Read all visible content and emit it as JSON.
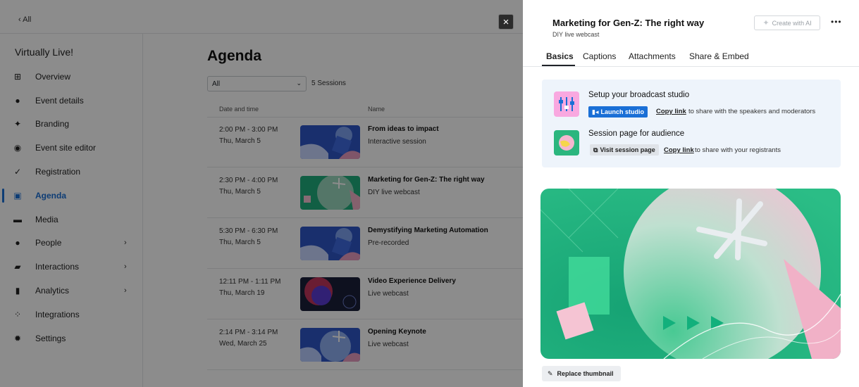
{
  "topbar": {
    "back_label": "All"
  },
  "sidebar": {
    "event_name": "Virtually Live!",
    "items": [
      {
        "label": "Overview",
        "icon": "grid-icon",
        "chevron": false
      },
      {
        "label": "Event details",
        "icon": "info-icon",
        "chevron": false
      },
      {
        "label": "Branding",
        "icon": "sparkle-icon",
        "chevron": false
      },
      {
        "label": "Event site editor",
        "icon": "globe-icon",
        "chevron": false
      },
      {
        "label": "Registration",
        "icon": "check-icon",
        "chevron": false
      },
      {
        "label": "Agenda",
        "icon": "calendar-icon",
        "chevron": false,
        "active": true
      },
      {
        "label": "Media",
        "icon": "folder-icon",
        "chevron": false
      },
      {
        "label": "People",
        "icon": "person-icon",
        "chevron": true
      },
      {
        "label": "Interactions",
        "icon": "chat-icon",
        "chevron": true
      },
      {
        "label": "Analytics",
        "icon": "bar-chart-icon",
        "chevron": true
      },
      {
        "label": "Integrations",
        "icon": "integrations-icon",
        "chevron": false
      },
      {
        "label": "Settings",
        "icon": "gear-icon",
        "chevron": false
      }
    ]
  },
  "agenda": {
    "title": "Agenda",
    "filter_value": "All",
    "session_count": "5 Sessions",
    "columns": {
      "date": "Date and time",
      "name": "Name"
    },
    "rows": [
      {
        "time": "2:00 PM - 3:00 PM",
        "date": "Thu, March 5",
        "title": "From ideas to impact",
        "type": "Interactive session",
        "thumb": "blue"
      },
      {
        "time": "2:30 PM - 4:00 PM",
        "date": "Thu, March 5",
        "title": "Marketing for Gen-Z: The right way",
        "type": "DIY live webcast",
        "thumb": "green"
      },
      {
        "time": "5:30 PM - 6:30 PM",
        "date": "Thu, March 5",
        "title": "Demystifying Marketing Automation",
        "type": "Pre-recorded",
        "thumb": "blue"
      },
      {
        "time": "12:11 PM - 1:11 PM",
        "date": "Thu, March 19",
        "title": "Video Experience Delivery",
        "type": "Live webcast",
        "thumb": "dark"
      },
      {
        "time": "2:14 PM - 3:14 PM",
        "date": "Wed, March 25",
        "title": "Opening Keynote",
        "type": "Live webcast",
        "thumb": "blue-star"
      }
    ]
  },
  "panel": {
    "title": "Marketing for Gen-Z: The right way",
    "subtitle": "DIY live webcast",
    "ai_button": "Create with AI",
    "more_label": "•••",
    "tabs": [
      "Basics",
      "Captions",
      "Attachments",
      "Share & Embed"
    ],
    "studio": {
      "title": "Setup your broadcast studio",
      "button": "Launch studio",
      "copy_link": "Copy link",
      "note": "to share with the speakers and moderators"
    },
    "audience": {
      "title": "Session page for audience",
      "button": "Visit session page",
      "copy_link": "Copy link",
      "note": "to share with your registrants"
    },
    "replace_button": "Replace thumbnail"
  },
  "colors": {
    "accent": "#1a6fd6",
    "hero_green": "#1fae7c",
    "hero_pink": "#f3b7c8",
    "card_bg": "#eef4fb"
  }
}
